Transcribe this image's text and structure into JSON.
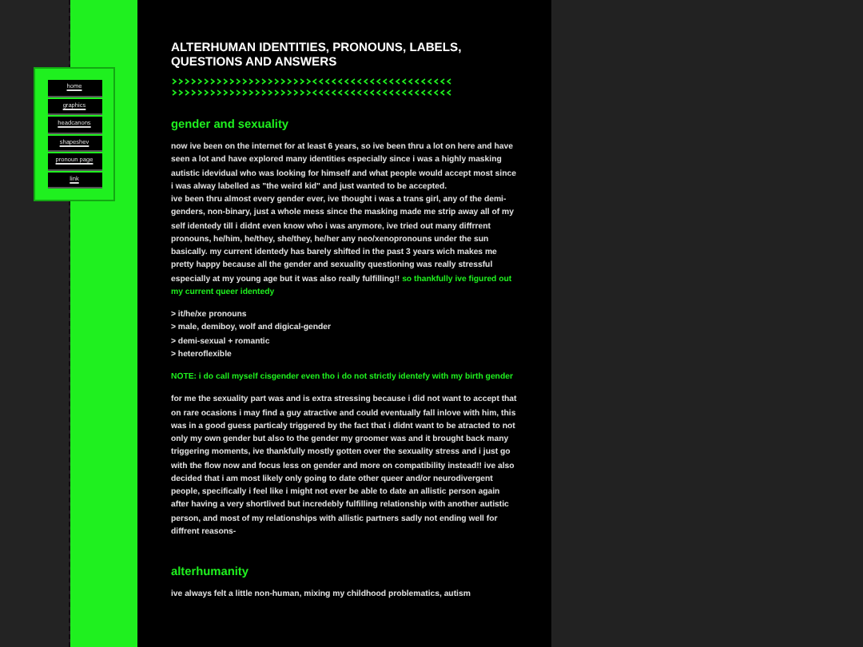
{
  "nav": {
    "items": [
      {
        "label": "home"
      },
      {
        "label": "graphics"
      },
      {
        "label": "headcanons"
      },
      {
        "label": "shapeshev"
      },
      {
        "label": "pronoun page"
      },
      {
        "label": "link"
      }
    ]
  },
  "title": "ALTERHUMAN IDENTITIES, PRONOUNS, LABELS, QUESTIONS AND ANSWERS",
  "sections": [
    {
      "heading": "gender and sexuality",
      "blocks": [
        {
          "kind": "paragraph",
          "lines": [
            "now ive been on the internet for at least 6 years, so ive been thru a lot on here and have seen a lot and have explored many identities especially since i was a highly masking autistic idevidual who was looking for himself and what people would accept most since i was alway labelled as \"the weird kid\" and just wanted to be accepted.",
            "ive been thru almost every gender ever, ive thought i was a trans girl, any of the demi-genders, non-binary, just a whole mess since the masking made me strip away all of my self identedy till i didnt even know who i was anymore, ive tried out many diffrrent pronouns, he/him, he/they, she/they, he/her any neo/xenopronouns under the sun basically. my current identedy has barely shifted in the past 3 years wich makes me pretty happy because all the gender and sexuality questioning was really stressful especially at my young age but it was also really fulfilling!!"
          ],
          "highlight": "so thankfully ive figured out my current queer identedy"
        },
        {
          "kind": "list",
          "items": [
            "> it/he/xe pronouns",
            "> male, demiboy, wolf and digical-gender",
            "> demi-sexual + romantic",
            "> heteroflexible"
          ]
        },
        {
          "kind": "note",
          "text": " NOTE: i do call myself cisgender even tho i do not strictly identefy with my birth gender"
        },
        {
          "kind": "paragraph",
          "lines": [
            "for me the sexuality part was and is extra stressing because i did not want to accept that on rare ocasions i may find a guy atractive and could eventually fall inlove with him, this was in a good guess particaly triggered by the fact that i didnt want to be atracted to not only my own gender but also to the gender my groomer was and it brought back many triggering moments, ive thankfully mostly gotten over the sexuality stress and i just go with the flow now and focus less on gender and more on compatibility instead!! ive also decided that i am most likely only going to date other queer and/or neurodivergent people, specifically i feel like i might not ever be able to date an allistic person again after having a very shortlived but incredebly fulfilling relationship with another autistic person, and most of my relationships with allistic partners sadly not ending well for diffrent reasons-"
          ]
        }
      ]
    },
    {
      "heading": "alterhumanity",
      "blocks": [
        {
          "kind": "paragraph",
          "lines": [
            "ive always felt a little non-human, mixing my childhood problematics, autism"
          ]
        }
      ]
    }
  ]
}
